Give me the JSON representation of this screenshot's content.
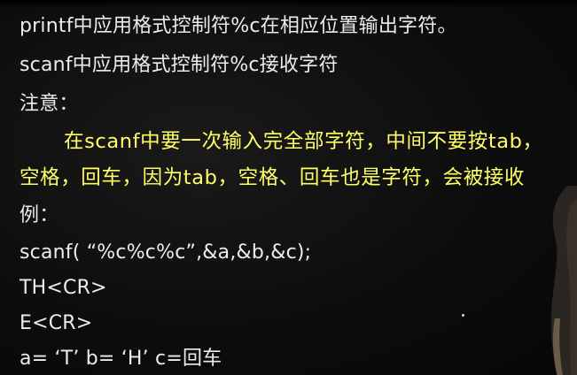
{
  "lines": [
    "printf中应用格式控制符%c在相应位置输出字符。",
    "scanf中应用格式控制符%c接收字符",
    "注意：",
    "在scanf中要一次输入完全部字符，中间不要按tab，",
    "空格，回车，因为tab，空格、回车也是字符，会被接收",
    "例：",
    "scanf( “%c%c%c”,&a,&b,&c);",
    "TH<CR>",
    "E<CR>",
    "a= ‘T’  b= ‘H’  c=回车"
  ],
  "colors": {
    "white_text": "#ececec",
    "yellow_text": "#ffff66",
    "background": "#0b0b0b"
  }
}
